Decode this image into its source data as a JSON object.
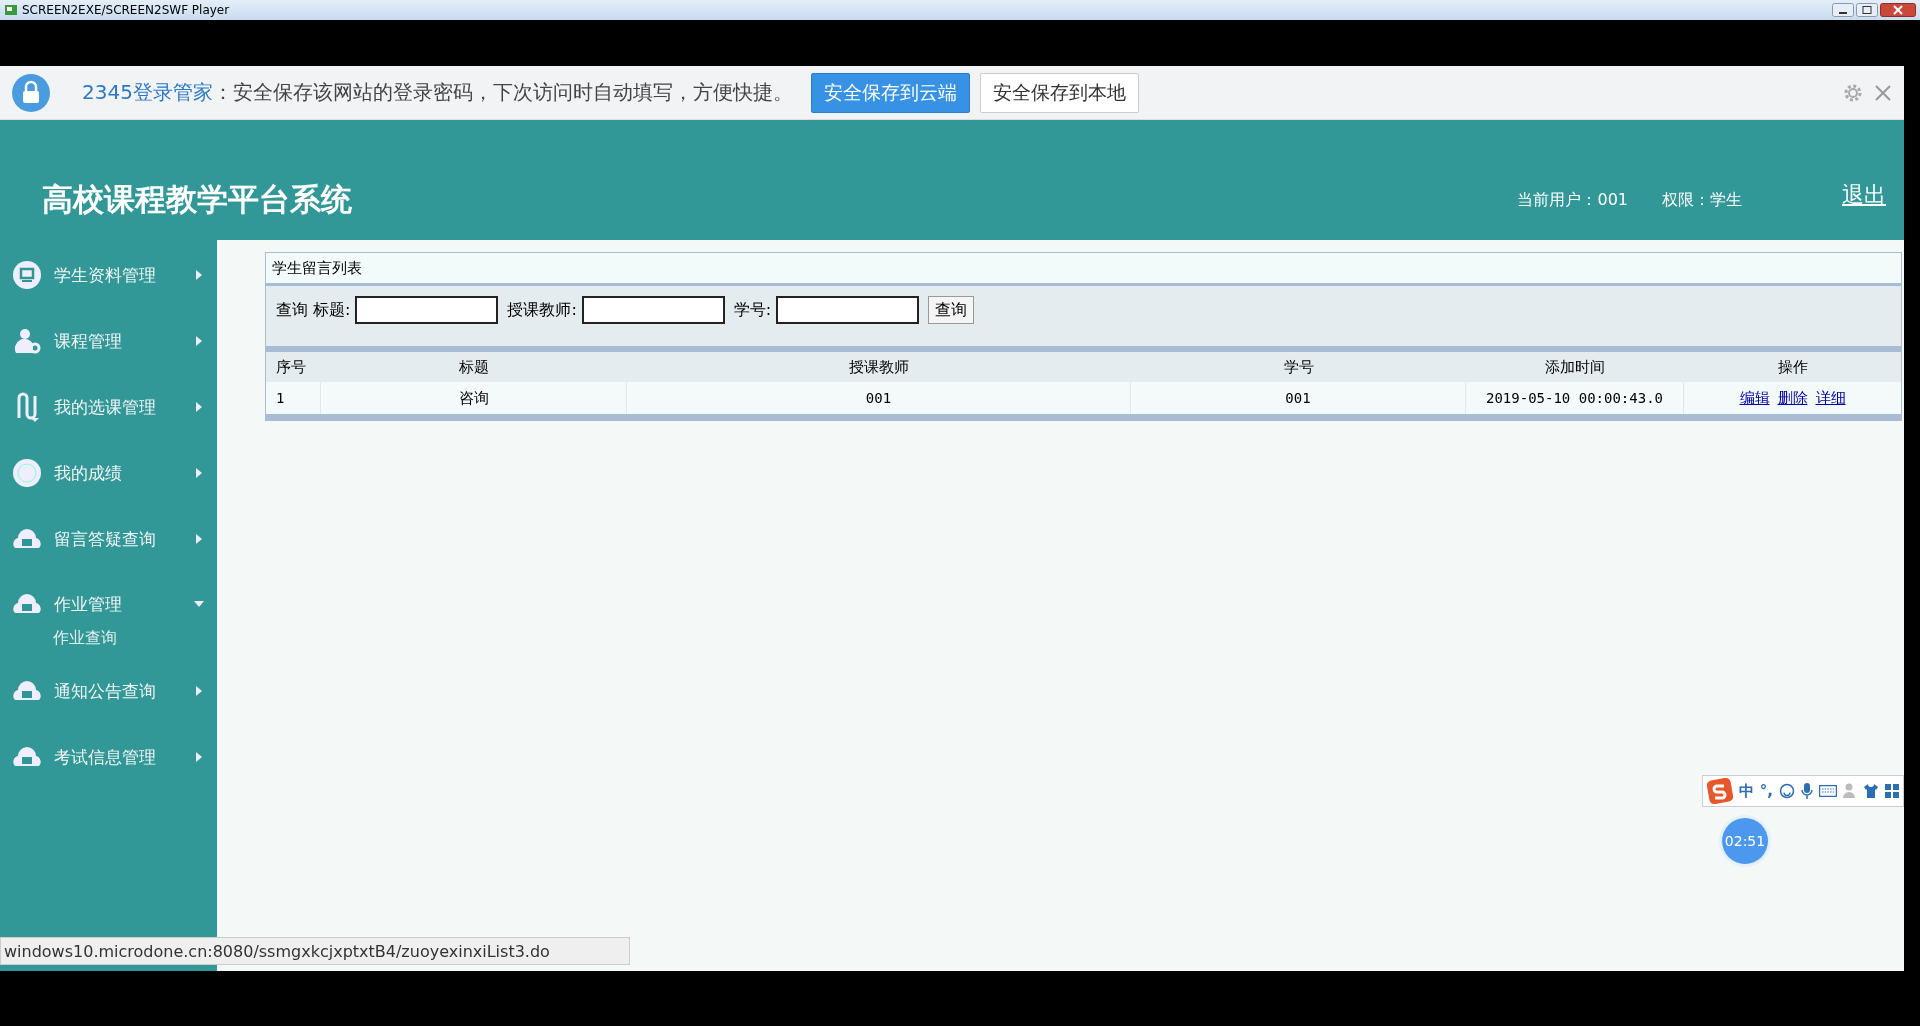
{
  "window": {
    "title": "SCREEN2EXE/SCREEN2SWF Player"
  },
  "password_bar": {
    "brand": "2345登录管家",
    "message": "：安全保存该网站的登录密码，下次访问时自动填写，方便快捷。",
    "buttons": [
      {
        "label": "安全保存到云端",
        "kind": "primary"
      },
      {
        "label": "安全保存到本地",
        "kind": "secondary"
      }
    ]
  },
  "header": {
    "title": "高校课程教学平台系统",
    "user": "当前用户：001",
    "role": "权限：学生",
    "logout": "退出"
  },
  "sidebar": {
    "items": [
      {
        "label": "学生资料管理",
        "expanded": false
      },
      {
        "label": "课程管理",
        "expanded": false
      },
      {
        "label": "我的选课管理",
        "expanded": false
      },
      {
        "label": "我的成绩",
        "expanded": false
      },
      {
        "label": "留言答疑查询",
        "expanded": false
      },
      {
        "label": "作业管理",
        "expanded": true,
        "children": [
          {
            "label": "作业查询"
          }
        ]
      },
      {
        "label": "通知公告查询",
        "expanded": false
      },
      {
        "label": "考试信息管理",
        "expanded": false
      }
    ]
  },
  "panel": {
    "title": "学生留言列表",
    "search": {
      "prefix": "查询",
      "fields": [
        {
          "label": "标题:"
        },
        {
          "label": "授课教师:"
        },
        {
          "label": "学号:"
        }
      ],
      "button": "查询"
    },
    "table": {
      "columns": [
        "序号",
        "标题",
        "授课教师",
        "学号",
        "添加时间",
        "操作"
      ],
      "rows": [
        {
          "cells": [
            "1",
            "咨询",
            "001",
            "001",
            "2019-05-10 00:00:43.0"
          ],
          "actions": [
            "编辑",
            "删除",
            "详细"
          ]
        }
      ]
    }
  },
  "status_bar": {
    "url": "windows10.microdone.cn:8080/ssmgxkcjxptxtB4/zuoyexinxiList3.do"
  },
  "ime_toolbar": {
    "mode": "中",
    "punct": "°,"
  },
  "timer": {
    "time": "02:51"
  }
}
